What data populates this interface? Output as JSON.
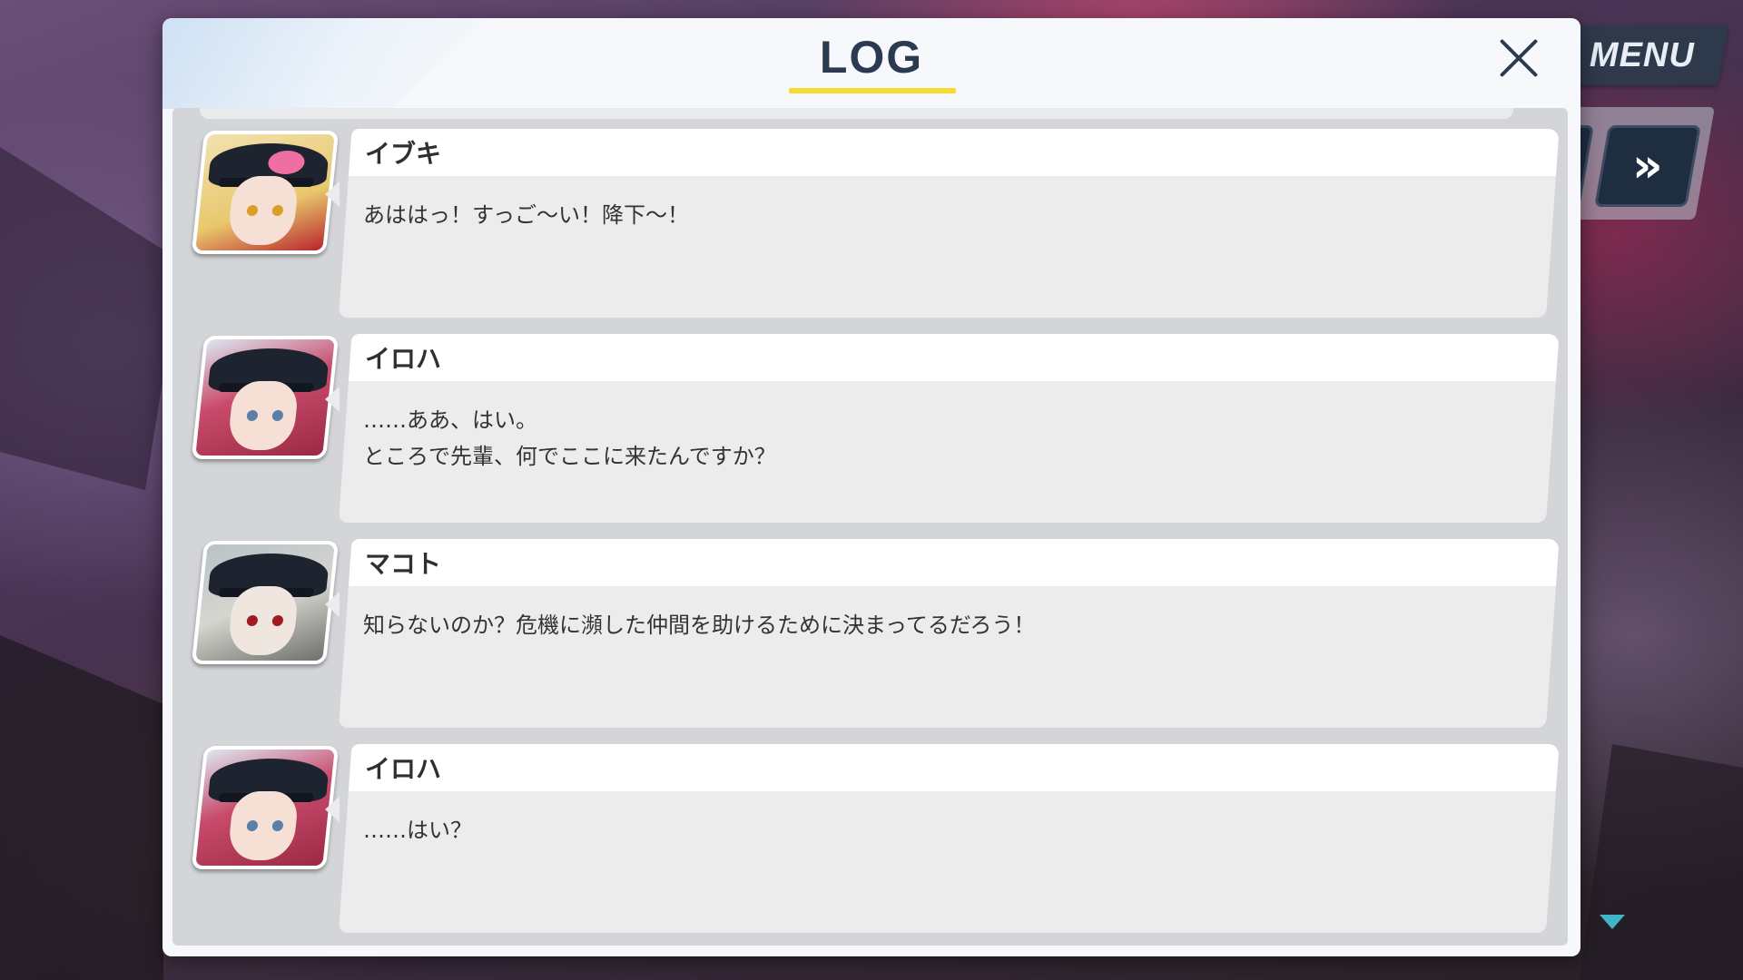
{
  "window": {
    "title": "LOG",
    "close_icon": "close-icon",
    "menu_label": "MENU",
    "auto_icon": "auto-play-icon",
    "fast_forward_label": "»",
    "scroll_indicator_icon": "scroll-down-arrow-icon",
    "accent_color": "#f3dc2d"
  },
  "log": {
    "entries": [
      {
        "speaker": "イブキ",
        "avatar": "ibuki-portrait",
        "lines": [
          "あははっ！すっご〜い！降下〜！"
        ]
      },
      {
        "speaker": "イロハ",
        "avatar": "iroha-portrait",
        "lines": [
          "……ああ、はい。",
          "ところで先輩、何でここに来たんですか？"
        ]
      },
      {
        "speaker": "マコト",
        "avatar": "makoto-portrait",
        "lines": [
          "知らないのか？危機に瀕した仲間を助けるために決まってるだろう！"
        ]
      },
      {
        "speaker": "イロハ",
        "avatar": "iroha-portrait",
        "lines": [
          "……はい？"
        ]
      }
    ]
  }
}
